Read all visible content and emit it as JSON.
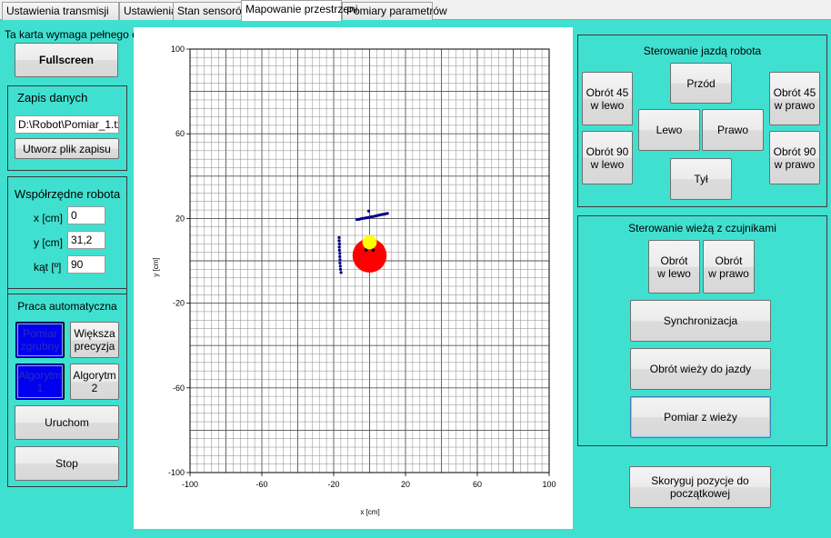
{
  "tabs": [
    {
      "label": "Ustawienia transmisji",
      "active": false
    },
    {
      "label": "Ustawienia robota",
      "active": false
    },
    {
      "label": "Stan sensorów",
      "active": false
    },
    {
      "label": "Mapowanie przestrzeni",
      "active": true
    },
    {
      "label": "Pomiary parametrów",
      "active": false
    }
  ],
  "left": {
    "fullscreen_hint": "Ta karta wymaga pełnego okna",
    "fullscreen_button": "Fullscreen",
    "save": {
      "title": "Zapis danych",
      "path_value": "D:\\Robot\\Pomiar_1.txt",
      "create_button": "Utworz plik zapisu"
    },
    "coords": {
      "title": "Współrzędne  robota",
      "x_label": "x [cm]",
      "x_value": "0",
      "y_label": "y [cm]",
      "y_value": "31,2",
      "angle_label": "kąt [º]",
      "angle_value": "90"
    },
    "auto": {
      "title": "Praca automatyczna",
      "mode_coarse": "Pomiar\nzgrubny",
      "mode_precise": "Większa\nprecyzja",
      "algo1": "Algorytm\n1",
      "algo2": "Algorytm\n2",
      "start_button": "Uruchom",
      "stop_button": "Stop"
    }
  },
  "drive": {
    "title": "Sterowanie jazdą robota",
    "rot45_left": "Obrót 45\nw lewo",
    "forward": "Przód",
    "rot45_right": "Obrót 45\nw prawo",
    "left": "Lewo",
    "right": "Prawo",
    "rot90_left": "Obrót 90\nw lewo",
    "rot90_right": "Obrót 90\nw prawo",
    "back": "Tył"
  },
  "turret": {
    "title": "Sterowanie wieżą z czujnikami",
    "rot_left": "Obrót\nw lewo",
    "rot_right": "Obrót\nw prawo",
    "sync": "Synchronizacja",
    "rot_drive": "Obrót wieży do jazdy",
    "measure": "Pomiar z wieży"
  },
  "correct_button": "Skoryguj pozycje do\npoczątkowej",
  "colors": {
    "background": "#40e0d0",
    "points": "#00008b",
    "robot": "#ff0000",
    "highlight": "#ffff00"
  },
  "chart_data": {
    "type": "scatter",
    "title": "",
    "xlabel": "x [cm]",
    "ylabel": "y [cm]",
    "xlim": [
      -100,
      100
    ],
    "ylim": [
      -100,
      100
    ],
    "xticks": [
      "-100",
      "-60",
      "-20",
      "20",
      "60",
      "100"
    ],
    "yticks": [
      "100",
      "60",
      "20",
      "-20",
      "-60",
      "-100"
    ],
    "grid": true,
    "series": [
      {
        "values": [
          [
            -7,
            19.5
          ],
          [
            -6,
            19.6
          ],
          [
            -5,
            19.8
          ],
          [
            -4,
            20.0
          ],
          [
            -3,
            20.1
          ],
          [
            -2,
            20.3
          ],
          [
            -1,
            20.4
          ],
          [
            0,
            20.6
          ],
          [
            1,
            20.8
          ],
          [
            2,
            20.9
          ],
          [
            3,
            21.1
          ],
          [
            4,
            21.3
          ],
          [
            5,
            21.5
          ],
          [
            6,
            21.7
          ],
          [
            7,
            21.9
          ],
          [
            8,
            22.0
          ],
          [
            9,
            22.2
          ],
          [
            10,
            22.4
          ],
          [
            -0.5,
            23.5
          ],
          [
            -17,
            11.0
          ],
          [
            -17,
            9.5
          ],
          [
            -16.8,
            8.0
          ],
          [
            -16.9,
            6.5
          ],
          [
            -16.8,
            5.0
          ],
          [
            -16.6,
            3.5
          ],
          [
            -16.6,
            2.0
          ],
          [
            -16.5,
            0.5
          ],
          [
            -16.5,
            -1.0
          ],
          [
            -16.3,
            -2.5
          ],
          [
            -16.2,
            -4.0
          ],
          [
            -15.9,
            -5.5
          ]
        ]
      }
    ],
    "robot": {
      "x": 0,
      "y": 2.5,
      "r": 9.5
    }
  }
}
